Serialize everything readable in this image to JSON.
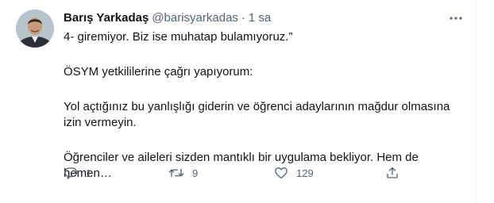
{
  "tweet": {
    "author_name": "Barış Yarkadaş",
    "author_handle": "@barisyarkadas",
    "separator": "·",
    "time": "1 sa",
    "paragraphs": [
      "4- giremiyor. Biz ise muhatap bulamıyoruz.”",
      "ÖSYM yetkililerine çağrı yapıyorum:",
      "Yol açtığınız bu yanlışlığı giderin ve öğrenci adaylarının mağdur olmasına izin vermeyin.",
      "Öğrenciler ve aileleri sizden mantıklı bir uygulama bekliyor. Hem de hemen…"
    ]
  },
  "actions": {
    "reply_icon": "reply-icon",
    "reply_count": "1",
    "retweet_icon": "retweet-icon",
    "retweet_count": "9",
    "like_icon": "heart-icon",
    "like_count": "129",
    "share_icon": "share-icon"
  },
  "colors": {
    "text": "#0f1419",
    "secondary": "#536471",
    "divider": "#eff3f4"
  }
}
